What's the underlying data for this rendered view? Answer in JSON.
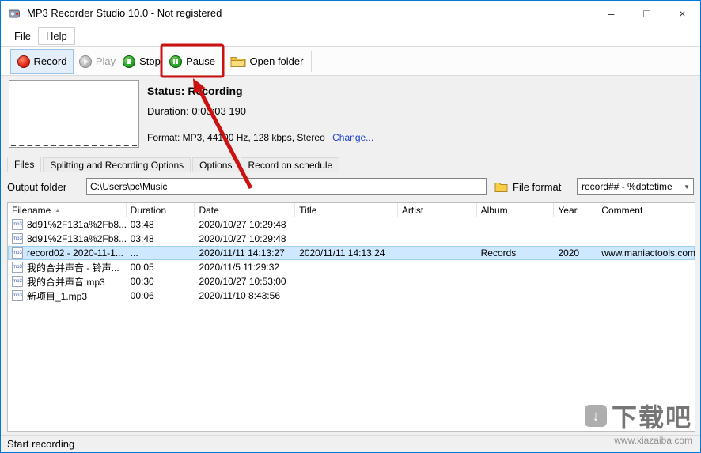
{
  "window": {
    "title": "MP3 Recorder Studio 10.0 - Not registered",
    "minimize": "–",
    "maximize": "□",
    "close": "×"
  },
  "menu": {
    "file": "File",
    "help": "Help"
  },
  "toolbar": {
    "record_accel": "R",
    "record_rest": "ecord",
    "play": "Play",
    "stop": "Stop",
    "pause": "Pause",
    "open_folder": "Open folder"
  },
  "status_panel": {
    "status": "Status: Recording",
    "duration": "Duration: 0:00:03 190",
    "format": "Format: MP3, 44100 Hz, 128 kbps, Stereo",
    "change_link": "Change..."
  },
  "tabs": {
    "files": "Files",
    "splitting": "Splitting and Recording Options",
    "options": "Options",
    "schedule": "Record on schedule"
  },
  "output": {
    "label": "Output folder",
    "path": "C:\\Users\\pc\\Music",
    "file_format_label": "File format",
    "file_format_value": "record## - %datetime"
  },
  "icons": {
    "mp3": "mp3",
    "sort": "▲",
    "dropdown": "▼",
    "download_arrow": "↓"
  },
  "table": {
    "columns": [
      "Filename",
      "Duration",
      "Date",
      "Title",
      "Artist",
      "Album",
      "Year",
      "Comment"
    ],
    "rows": [
      [
        "8d91%2F131a%2Fb8...",
        "03:48",
        "2020/10/27 10:29:48",
        "",
        "",
        "",
        "",
        ""
      ],
      [
        "8d91%2F131a%2Fb8...",
        "03:48",
        "2020/10/27 10:29:48",
        "",
        "",
        "",
        "",
        ""
      ],
      [
        "record02 - 2020-11-1...",
        "...",
        "2020/11/11 14:13:27",
        "2020/11/11 14:13:24",
        "",
        "Records",
        "2020",
        "www.maniactools.com"
      ],
      [
        "我的合并声音 - 铃声...",
        "00:05",
        "2020/11/5 11:29:32",
        "",
        "",
        "",
        "",
        ""
      ],
      [
        "我的合并声音.mp3",
        "00:30",
        "2020/10/27 10:53:00",
        "",
        "",
        "",
        "",
        ""
      ],
      [
        "新项目_1.mp3",
        "00:06",
        "2020/11/10 8:43:56",
        "",
        "",
        "",
        "",
        ""
      ]
    ]
  },
  "statusbar": {
    "text": "Start recording"
  },
  "watermark": {
    "title": "下载吧",
    "url": "www.xiazaiba.com"
  },
  "colors": {
    "accent": "#0078d7",
    "annotation": "#cc1111",
    "selection": "#cde8ff",
    "link": "#1f3fd0"
  }
}
